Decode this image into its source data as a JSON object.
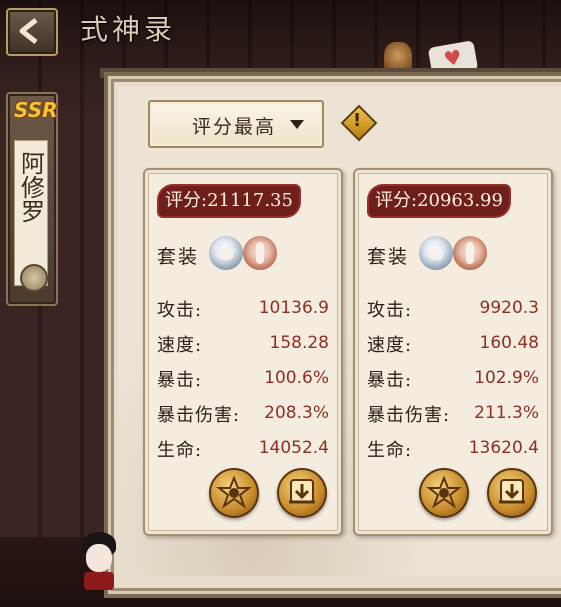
{
  "header": {
    "title": "式神录",
    "back_icon": "chevron-left-icon"
  },
  "character": {
    "rarity": "SSR",
    "name": "阿修罗"
  },
  "sort": {
    "selected": "评分最高",
    "info_icon": "exclamation-diamond-icon"
  },
  "cards": [
    {
      "score": "评分:21117.35",
      "set_label": "套装",
      "stats": [
        {
          "name": "攻击:",
          "value": "10136.9"
        },
        {
          "name": "速度:",
          "value": "158.28"
        },
        {
          "name": "暴击:",
          "value": "100.6%"
        },
        {
          "name": "暴击伤害:",
          "value": "208.3%"
        },
        {
          "name": "生命:",
          "value": "14052.4"
        }
      ]
    },
    {
      "score": "评分:20963.99",
      "set_label": "套装",
      "stats": [
        {
          "name": "攻击:",
          "value": "9920.3"
        },
        {
          "name": "速度:",
          "value": "160.48"
        },
        {
          "name": "暴击:",
          "value": "102.9%"
        },
        {
          "name": "暴击伤害:",
          "value": "211.3%"
        },
        {
          "name": "生命:",
          "value": "13620.4"
        }
      ]
    }
  ],
  "colors": {
    "score_badge": "#6e1f1b",
    "stat_value": "#8e2f26",
    "rarity": "#f4c435"
  }
}
